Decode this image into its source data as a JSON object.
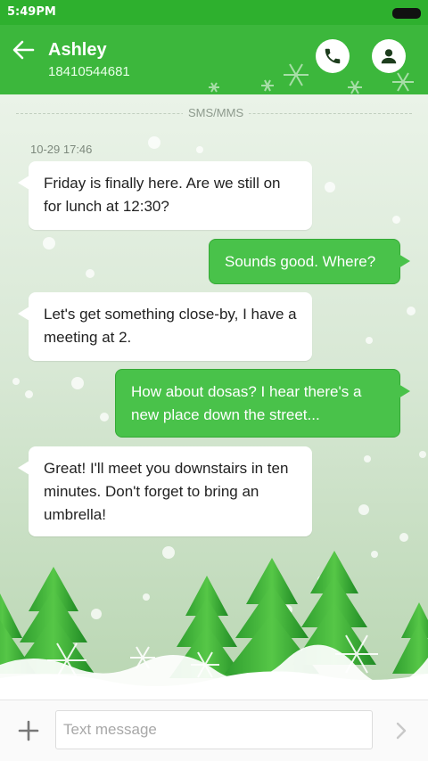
{
  "status_bar": {
    "time": "5:49PM"
  },
  "header": {
    "name": "Ashley",
    "number": "18410544681"
  },
  "thread": {
    "channel_label": "SMS/MMS",
    "timestamp": "10-29 17:46",
    "messages": [
      {
        "direction": "incoming",
        "text": "Friday is finally here. Are we still on for lunch at 12:30?"
      },
      {
        "direction": "outgoing",
        "text": "Sounds good. Where?"
      },
      {
        "direction": "incoming",
        "text": "Let's get something close-by, I have a meeting at 2."
      },
      {
        "direction": "outgoing",
        "text": "How about dosas? I hear there's a new place down the street..."
      },
      {
        "direction": "incoming",
        "text": "Great! I'll meet you downstairs in ten minutes. Don't forget to bring an umbrella!"
      }
    ]
  },
  "composer": {
    "placeholder": "Text message"
  },
  "colors": {
    "accent": "#3cb73c",
    "outgoing_bubble": "#49c24a",
    "incoming_bubble": "#ffffff"
  }
}
